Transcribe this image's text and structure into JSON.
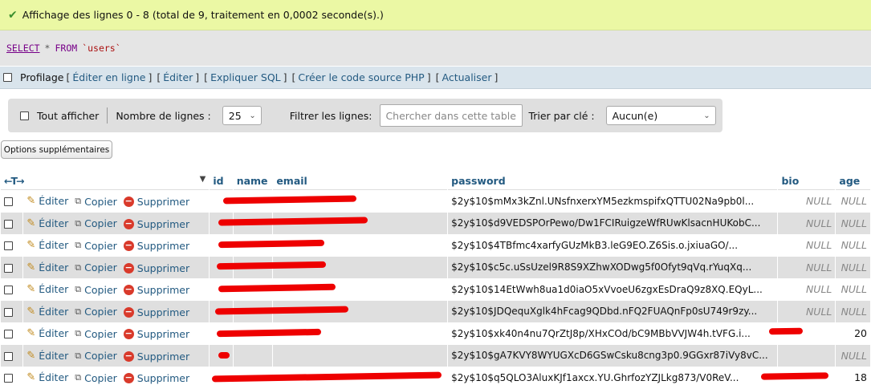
{
  "success": {
    "message": "Affichage des lignes 0 - 8 (total de 9, traitement en 0,0002 seconde(s).)"
  },
  "sql": {
    "select": "SELECT",
    "star": "*",
    "from": "FROM",
    "table": "`users`"
  },
  "profil": {
    "label": "Profilage",
    "links": [
      "Éditer en ligne",
      "Éditer",
      "Expliquer SQL",
      "Créer le code source PHP",
      "Actualiser"
    ]
  },
  "nav": {
    "show_all": "Tout afficher",
    "rows_label": "Nombre de lignes :",
    "rows_value": "25",
    "filter_label": "Filtrer les lignes:",
    "filter_placeholder": "Chercher dans cette table",
    "sort_label": "Trier par clé :",
    "sort_value": "Aucun(e)"
  },
  "options_button": "Options supplémentaires",
  "table": {
    "columns": [
      "id",
      "name",
      "email",
      "password",
      "bio",
      "age"
    ],
    "actions": {
      "edit": "Éditer",
      "copy": "Copier",
      "delete": "Supprimer"
    },
    "rows": [
      {
        "password": "$2y$10$mMx3kZnl.UNsfnxerxYM5ezkmspifxQTTU02Na9pb0l...",
        "bio": "NULL",
        "age": "NULL"
      },
      {
        "password": "$2y$10$d9VEDSPOrPewo/Dw1FCIRuigzeWfRUwKlsacnHUKobC...",
        "bio": "NULL",
        "age": "NULL"
      },
      {
        "password": "$2y$10$4TBfmc4xarfyGUzMkB3.leG9EO.Z6Sis.o.jxiuaGO/...",
        "bio": "NULL",
        "age": "NULL"
      },
      {
        "password": "$2y$10$c5c.uSsUzel9R8S9XZhwXODwg5f0Ofyt9qVq.rYuqXq...",
        "bio": "NULL",
        "age": "NULL"
      },
      {
        "password": "$2y$10$14EtWwh8ua1d0iaO5xVvoeU6zgxEsDraQ9z8XQ.EQyL...",
        "bio": "NULL",
        "age": "NULL"
      },
      {
        "password": "$2y$10$JDQequXglk4hFcag9QDbd.nFQ2FUAQnFp0sU749r9zy...",
        "bio": "NULL",
        "age": "NULL"
      },
      {
        "password": "$2y$10$xk40n4nu7QrZtJ8p/XHxCOd/bC9MBbVVJW4h.tVFG.i...",
        "bio": "",
        "age": "20"
      },
      {
        "password": "$2y$10$gA7KVY8WYUGXcD6GSwCsku8cng3p0.9GGxr87iVy8vC...",
        "bio": "",
        "age": "NULL"
      },
      {
        "password": "$2y$10$q5QLO3AluxKJf1axcx.YU.GhrfozYZJLkg873/V0ReV...",
        "bio": "",
        "age": "18"
      }
    ]
  }
}
